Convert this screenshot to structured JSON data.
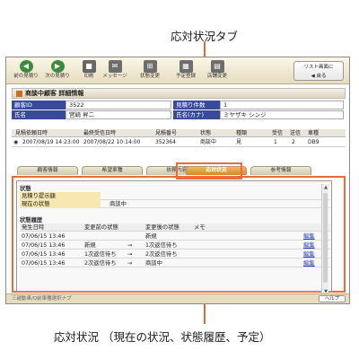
{
  "annotations": {
    "tab_callout": "応対状況タブ",
    "panel_callout": "応対状況 （現在の状況、状態履歴、予定）"
  },
  "toolbar": {
    "prev": "前の見積り",
    "next": "次の見積り",
    "print": "印刷",
    "message": "メッセージ",
    "status_change": "状態変更",
    "schedule": "予定登録",
    "store_change": "店舗変更",
    "back_line1": "リスト画面に",
    "back_line2": "戻る"
  },
  "detail": {
    "title": "商談中顧客 詳細情報",
    "customer_id_label": "顧客ID",
    "customer_id": "3522",
    "estimate_count_label": "見積り件数",
    "estimate_count": "1",
    "name_label": "氏名",
    "name": "宮崎 昇二",
    "name_kana_label": "氏名(カナ)",
    "name_kana": "ミヤザキ シンジ"
  },
  "history": {
    "headers": [
      "見積依頼日時",
      "最終受信日時",
      "見積番号",
      "状態",
      "種類",
      "受信",
      "送信",
      "車種"
    ],
    "row": [
      "2007/08/19 14:23:00",
      "2007/08/22 10:14:00",
      "352364",
      "商談中",
      "見",
      "1",
      "2",
      "DB9"
    ]
  },
  "tabs": [
    "顧客情報",
    "希望車種",
    "依頼内容",
    "応対状況",
    "参考情報"
  ],
  "panel": {
    "status_title": "状態",
    "quote_label": "見積り提示額",
    "current_label": "現在の状態",
    "current_value": "商談中",
    "history_title": "状態履歴",
    "cols": [
      "発生日時",
      "変更前の状態",
      "変更後の状態",
      "メモ"
    ],
    "rows": [
      {
        "date": "07/06/15 13:46",
        "before": "",
        "after": "新規"
      },
      {
        "date": "07/06/15 13:46",
        "before": "新規",
        "after": "1次返信待ち"
      },
      {
        "date": "07/06/15 13:46",
        "before": "1次返信待ち",
        "after": "2次返信待ち"
      },
      {
        "date": "07/06/15 13:46",
        "before": "2次返信待ち",
        "after": "商談中"
      }
    ],
    "edit": "編集"
  },
  "status": {
    "text": "三越動車/Q前車種選択ナブ",
    "help": "ヘルプ"
  }
}
